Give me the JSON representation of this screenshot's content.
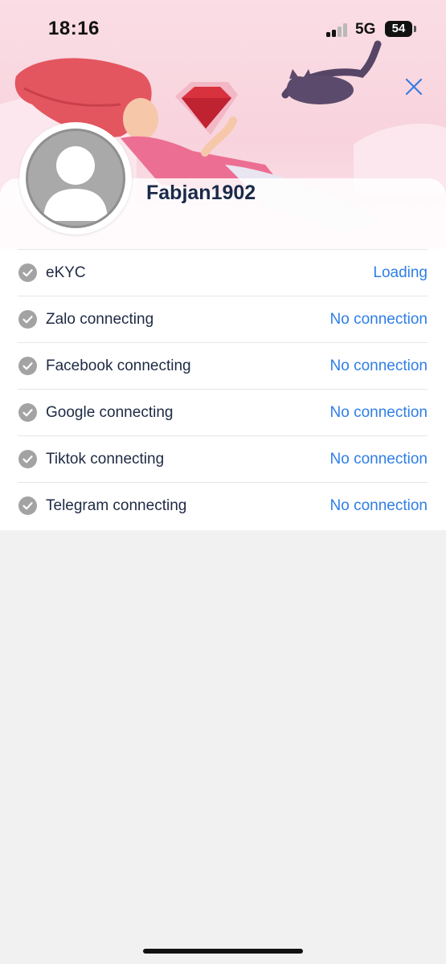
{
  "status_bar": {
    "time": "18:16",
    "network": "5G",
    "battery": "54"
  },
  "profile": {
    "username": "Fabjan1902"
  },
  "connections": [
    {
      "label": "eKYC",
      "status": "Loading"
    },
    {
      "label": "Zalo connecting",
      "status": "No connection"
    },
    {
      "label": "Facebook connecting",
      "status": "No connection"
    },
    {
      "label": "Google connecting",
      "status": "No connection"
    },
    {
      "label": "Tiktok connecting",
      "status": "No connection"
    },
    {
      "label": "Telegram connecting",
      "status": "No connection"
    }
  ],
  "colors": {
    "accent": "#2e7ee6",
    "text": "#1e2a44",
    "banner": "#f8d3dd",
    "check": "#a3a3a3"
  },
  "icons": {
    "close": "close-icon",
    "check": "check-circle-icon",
    "avatar": "user-placeholder-icon"
  }
}
